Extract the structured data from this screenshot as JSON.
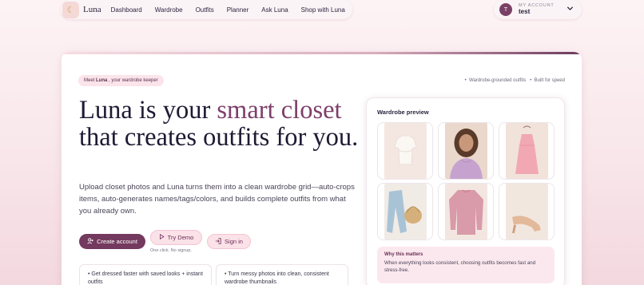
{
  "app": {
    "name": "Luna"
  },
  "nav": {
    "items": [
      "Dashboard",
      "Wardrobe",
      "Outfits",
      "Planner",
      "Ask Luna",
      "Shop with Luna"
    ]
  },
  "account": {
    "label": "MY ACCOUNT",
    "username": "test",
    "avatar_initial": "T"
  },
  "hero": {
    "meet_prefix": "Meet ",
    "meet_name": "Luna",
    "meet_suffix": " , your wardrobe keeper",
    "tags": "•  Wardrobe-grounded outfits   •  Built for speed",
    "headline_part1": "Luna is your ",
    "headline_accent": "smart closet",
    "headline_part2": " that creates outfits for you.",
    "description": "Upload closet photos and Luna turns them into a clean wardrobe grid—auto-crops items, auto-generates names/tags/colors, and builds complete outfits from what you already own.",
    "create_account": "Create account",
    "try_demo": "Try Demo",
    "sign_in": "Sign in",
    "one_click": "One click. No signup.",
    "features": [
      "•  Get dressed faster with saved looks + instant outfits",
      "•  Turn messy photos into clean, consistent wardrobe thumbnails"
    ]
  },
  "preview": {
    "title": "Wardrobe preview",
    "items": [
      "white-top",
      "woman-lilac-top",
      "pink-dress",
      "jeans-bag",
      "pink-sweater",
      "beige-heels"
    ],
    "why_title": "Why this matters",
    "why_body": "When everything looks consistent, choosing outfits becomes fast and stress-free."
  },
  "colors": {
    "accent": "#7d3f6a",
    "primary_button": "#74395f",
    "soft_pink": "#fbe1e8"
  }
}
